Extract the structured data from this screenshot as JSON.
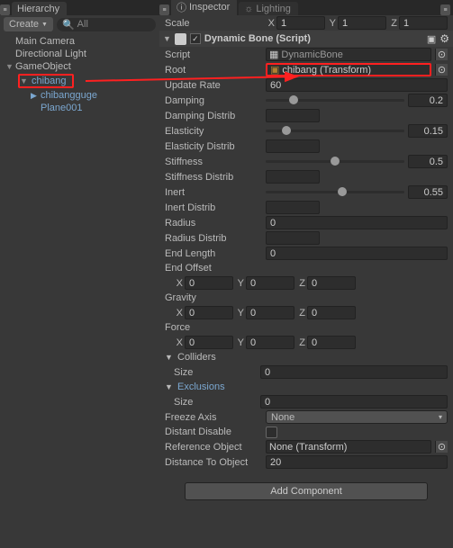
{
  "hierarchy": {
    "tab": "Hierarchy",
    "create": "Create",
    "search_placeholder": "All",
    "items": {
      "main_camera": "Main Camera",
      "directional_light": "Directional Light",
      "game_object": "GameObject",
      "chibang": "chibang",
      "chibangguge": "chibangguge",
      "plane001": "Plane001"
    }
  },
  "inspector": {
    "tab": "Inspector",
    "lighting_tab": "Lighting",
    "scale": {
      "label": "Scale",
      "x": "1",
      "y": "1",
      "z": "1"
    },
    "component": {
      "title": "Dynamic Bone (Script)",
      "script": {
        "label": "Script",
        "value": "DynamicBone"
      },
      "root": {
        "label": "Root",
        "value": "chibang (Transform)"
      },
      "update_rate": {
        "label": "Update Rate",
        "value": "60"
      },
      "damping": {
        "label": "Damping",
        "value": "0.2"
      },
      "damping_distrib": {
        "label": "Damping Distrib"
      },
      "elasticity": {
        "label": "Elasticity",
        "value": "0.15"
      },
      "elasticity_distrib": {
        "label": "Elasticity Distrib"
      },
      "stiffness": {
        "label": "Stiffness",
        "value": "0.5"
      },
      "stiffness_distrib": {
        "label": "Stiffness Distrib"
      },
      "inert": {
        "label": "Inert",
        "value": "0.55"
      },
      "inert_distrib": {
        "label": "Inert Distrib"
      },
      "radius": {
        "label": "Radius",
        "value": "0"
      },
      "radius_distrib": {
        "label": "Radius Distrib"
      },
      "end_length": {
        "label": "End Length",
        "value": "0"
      },
      "end_offset": {
        "label": "End Offset",
        "x": "0",
        "y": "0",
        "z": "0"
      },
      "gravity": {
        "label": "Gravity",
        "x": "0",
        "y": "0",
        "z": "0"
      },
      "force": {
        "label": "Force",
        "x": "0",
        "y": "0",
        "z": "0"
      },
      "colliders": {
        "label": "Colliders",
        "size_label": "Size",
        "size": "0"
      },
      "exclusions": {
        "label": "Exclusions",
        "size_label": "Size",
        "size": "0"
      },
      "freeze_axis": {
        "label": "Freeze Axis",
        "value": "None"
      },
      "distant_disable": {
        "label": "Distant Disable"
      },
      "reference_object": {
        "label": "Reference Object",
        "value": "None (Transform)"
      },
      "distance_to_object": {
        "label": "Distance To Object",
        "value": "20"
      }
    },
    "add_component": "Add Component"
  }
}
